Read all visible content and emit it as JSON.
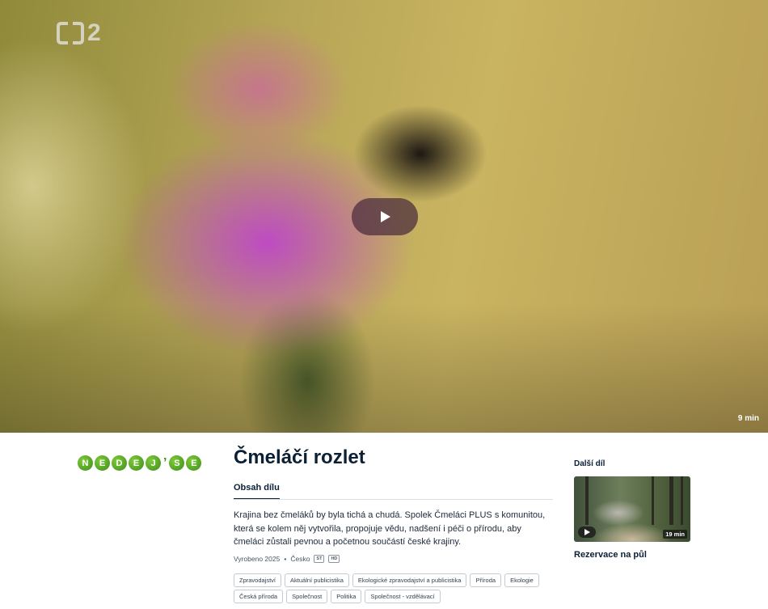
{
  "player": {
    "channel_logo_number": "2",
    "duration": "9 min",
    "play_icon": "play-icon"
  },
  "show": {
    "logo_letters": [
      "N",
      "E",
      "D",
      "E",
      "J",
      "S",
      "E"
    ],
    "logo_apostrophe": "’"
  },
  "episode": {
    "title": "Čmeláčí rozlet",
    "tab_label": "Obsah dílu",
    "description": "Krajina bez čmeláků by byla tichá a chudá. Spolek Čmeláci PLUS s komunitou, která se kolem něj vytvořila, propojuje vědu, nadšení i péči o přírodu, aby čmeláci zůstali pevnou a početnou součástí české krajiny.",
    "produced": "Vyrobeno 2025",
    "separator": "•",
    "country": "Česko",
    "badges": [
      "ST",
      "HD"
    ]
  },
  "tags": [
    "Zpravodajství",
    "Aktuální publicistika",
    "Ekologické zpravodajství a publicistika",
    "Příroda",
    "Ekologie",
    "Česká příroda",
    "Společnost",
    "Politika",
    "Společnost - vzdělávací"
  ],
  "next_episode": {
    "heading": "Další díl",
    "duration": "19 min",
    "title": "Rezervace na půl"
  },
  "colors": {
    "text_dark": "#0b1f35",
    "logo_green": "#3e8c1b"
  }
}
